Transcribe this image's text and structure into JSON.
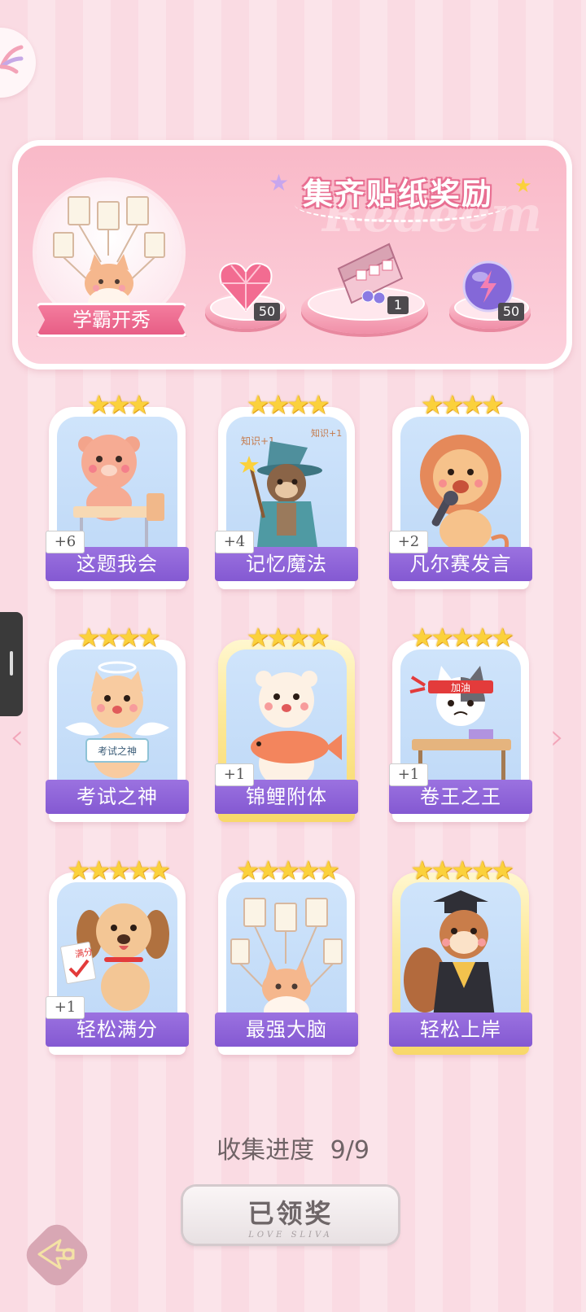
{
  "banner": {
    "title": "集齐贴纸奖励",
    "watermark": "Redeem",
    "badge_label": "学霸开秀",
    "rewards": [
      {
        "icon": "heart-gem-icon",
        "count": "50"
      },
      {
        "icon": "sticker-box-icon",
        "count": "1"
      },
      {
        "icon": "energy-orb-icon",
        "count": "50"
      }
    ]
  },
  "stickers": [
    {
      "label": "这题我会",
      "plus": "+6",
      "stars": "★★★",
      "rarity": "normal",
      "art": "bear-at-desk-icon"
    },
    {
      "label": "记忆魔法",
      "plus": "+4",
      "stars": "★★★★",
      "rarity": "normal",
      "art": "otter-wizard-icon",
      "note1": "知识+1",
      "note2": "知识+1"
    },
    {
      "label": "凡尔赛发言",
      "plus": "+2",
      "stars": "★★★★",
      "rarity": "normal",
      "art": "lion-microphone-icon"
    },
    {
      "label": "考试之神",
      "plus": "",
      "stars": "★★★★",
      "rarity": "normal",
      "art": "angel-cat-icon",
      "sign": "考试之神"
    },
    {
      "label": "锦鲤附体",
      "plus": "+1",
      "stars": "★★★★",
      "rarity": "gold",
      "art": "bear-koi-icon"
    },
    {
      "label": "卷王之王",
      "plus": "+1",
      "stars": "★★★★★",
      "rarity": "normal",
      "art": "cat-studying-icon",
      "headband": "加油"
    },
    {
      "label": "轻松满分",
      "plus": "+1",
      "stars": "★★★★★",
      "rarity": "normal",
      "art": "puppy-full-score-icon",
      "sign": "满分"
    },
    {
      "label": "最强大脑",
      "plus": "",
      "stars": "★★★★★",
      "rarity": "normal",
      "art": "cat-papers-icon"
    },
    {
      "label": "轻松上岸",
      "plus": "",
      "stars": "★★★★★",
      "rarity": "gold",
      "art": "squirrel-graduate-icon"
    }
  ],
  "progress": {
    "label": "收集进度",
    "value": "9/9"
  },
  "claim": {
    "label": "已领奖",
    "subtitle": "LOVE SLIVA"
  },
  "colors": {
    "accent_pink": "#e65b83",
    "label_purple": "#8459d2",
    "star_gold": "#fbd13c"
  }
}
